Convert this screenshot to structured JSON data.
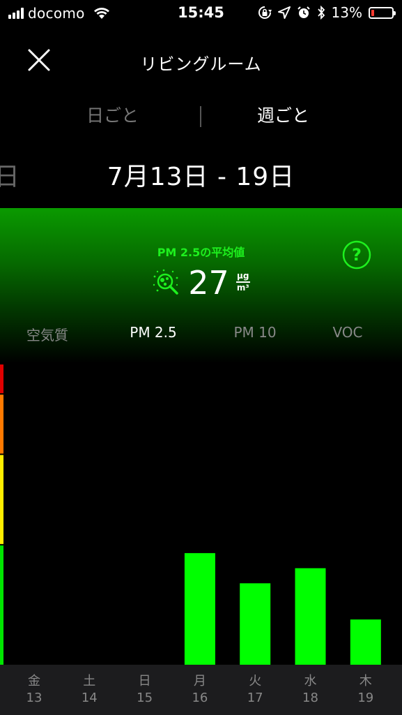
{
  "status_bar": {
    "carrier": "docomo",
    "time": "15:45",
    "battery_percent": "13%",
    "battery_level": 0.13,
    "icons": [
      "signal-icon",
      "wifi-icon",
      "orientation-lock-icon",
      "location-icon",
      "alarm-icon",
      "bluetooth-icon",
      "battery-icon"
    ]
  },
  "header": {
    "title": "リビングルーム",
    "close_icon": "close-icon"
  },
  "period_tabs": {
    "daily": "日ごと",
    "weekly": "週ごと",
    "selected": "weekly"
  },
  "date": {
    "range": "7月13日 - 19日",
    "prev_fragment": "日"
  },
  "summary": {
    "label": "PM 2.5の平均値",
    "value": "27",
    "unit_top": "μg",
    "unit_bottom": "m³",
    "icon": "particle-magnifier-icon",
    "help_icon": "help-icon",
    "accent_color": "#1ef01e"
  },
  "metric_tabs": [
    {
      "label": "空気質",
      "active": false
    },
    {
      "label": "PM 2.5",
      "active": true
    },
    {
      "label": "PM 10",
      "active": false
    },
    {
      "label": "VOC",
      "active": false
    }
  ],
  "chart_data": {
    "type": "bar",
    "categories": [
      "金 13",
      "土 14",
      "日 15",
      "月 16",
      "火 17",
      "水 18",
      "木 19"
    ],
    "values": [
      null,
      null,
      null,
      37,
      27,
      32,
      15
    ],
    "ylim": [
      0,
      100
    ],
    "bar_color": "#00ff00",
    "scale_colors": [
      "#00e600",
      "#ffee00",
      "#ff7a00",
      "#e00000"
    ]
  },
  "days": [
    {
      "weekday": "金",
      "date": "13"
    },
    {
      "weekday": "土",
      "date": "14"
    },
    {
      "weekday": "日",
      "date": "15"
    },
    {
      "weekday": "月",
      "date": "16"
    },
    {
      "weekday": "火",
      "date": "17"
    },
    {
      "weekday": "水",
      "date": "18"
    },
    {
      "weekday": "木",
      "date": "19"
    }
  ]
}
